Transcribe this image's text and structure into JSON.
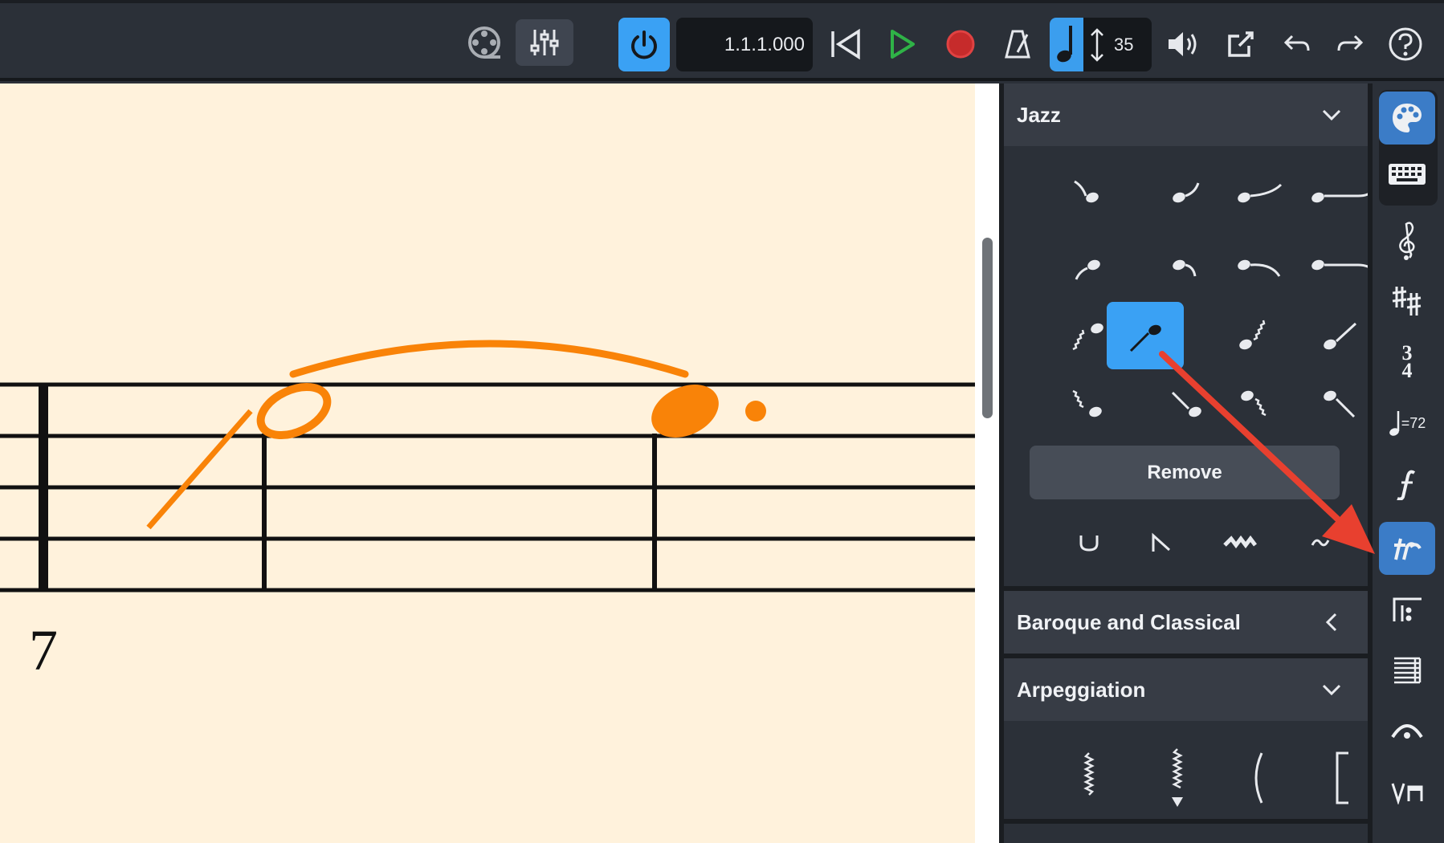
{
  "toolbar": {
    "position": "1.1.1.000",
    "tempo_value": "35",
    "icons": [
      "video-icon",
      "mixer-icon",
      "power-icon",
      "rewind-icon",
      "play-icon",
      "record-icon",
      "metronome-icon",
      "playback-speed-icon",
      "volume-icon",
      "share-icon",
      "undo-icon",
      "redo-icon",
      "help-icon"
    ]
  },
  "score": {
    "measure_number": "7"
  },
  "palettes": {
    "jazz": {
      "title": "Jazz",
      "remove_label": "Remove",
      "items": [
        "fall-short",
        "doit-short",
        "doit-medium",
        "doit-long",
        "scoop",
        "plop-short",
        "plop-medium",
        "plop-long",
        "slide-in-wavy",
        "slide-in-straight",
        "slide-out-wavy",
        "slide-out-straight",
        "slide-down-wavy",
        "slide-down-straight",
        "fall-wavy",
        "fall-straight",
        "smear",
        "bend",
        "shake",
        "turn"
      ]
    },
    "baroque": {
      "title": "Baroque and Classical"
    },
    "arpeggiation": {
      "title": "Arpeggiation"
    }
  },
  "rail": {
    "icons": [
      "palette-icon",
      "keyboard-icon",
      "clef-icon",
      "key-signature-icon",
      "time-signature-icon",
      "tempo-icon",
      "dynamics-icon",
      "ornaments-icon",
      "repeats-icon",
      "layout-icon",
      "fermata-icon",
      "bowing-icon"
    ],
    "tempo_label": "=72",
    "time_sig_top": "3",
    "time_sig_bottom": "4"
  },
  "colors": {
    "accent": "#3aa1f4",
    "score_bg": "#fff2dc",
    "selection": "#f98308",
    "annotation_arrow": "#e8402f"
  }
}
